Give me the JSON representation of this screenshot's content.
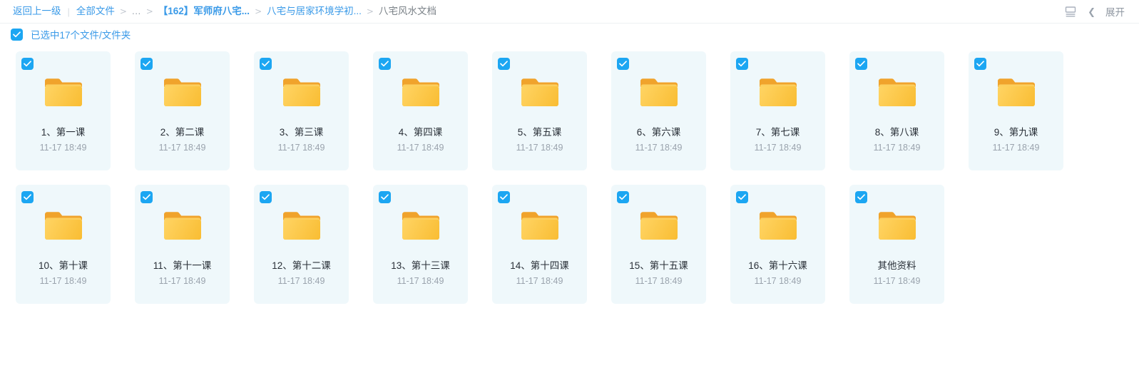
{
  "header": {
    "back_label": "返回上一级",
    "divider": "|",
    "separator": ">",
    "breadcrumb": [
      {
        "label": "全部文件",
        "style": "link"
      },
      {
        "label": "...",
        "style": "ellipsis"
      },
      {
        "label": "【162】军师府八宅...",
        "style": "strong"
      },
      {
        "label": "八宅与居家环境学初...",
        "style": "link"
      },
      {
        "label": "八宅风水文档",
        "style": "current"
      }
    ],
    "view_icon": "list-view-icon",
    "collapse_icon": "chevron-left-icon",
    "expand_label": "展开"
  },
  "selection": {
    "checked": true,
    "label": "已选中17个文件/文件夹"
  },
  "colors": {
    "accent": "#3a9ae8",
    "checkbox": "#1ca6f2",
    "card_bg": "#eff8fb",
    "folder_top": "#f3a72e",
    "folder_body": "#fdc63f",
    "name_text": "#2a3038",
    "date_text": "#9aa3ad"
  },
  "rows": [
    {
      "items": [
        {
          "name": "1、第一课",
          "date": "11-17 18:49",
          "checked": true,
          "icon": "folder-icon"
        },
        {
          "name": "2、第二课",
          "date": "11-17 18:49",
          "checked": true,
          "icon": "folder-icon"
        },
        {
          "name": "3、第三课",
          "date": "11-17 18:49",
          "checked": true,
          "icon": "folder-icon"
        },
        {
          "name": "4、第四课",
          "date": "11-17 18:49",
          "checked": true,
          "icon": "folder-icon"
        },
        {
          "name": "5、第五课",
          "date": "11-17 18:49",
          "checked": true,
          "icon": "folder-icon"
        },
        {
          "name": "6、第六课",
          "date": "11-17 18:49",
          "checked": true,
          "icon": "folder-icon"
        },
        {
          "name": "7、第七课",
          "date": "11-17 18:49",
          "checked": true,
          "icon": "folder-icon"
        },
        {
          "name": "8、第八课",
          "date": "11-17 18:49",
          "checked": true,
          "icon": "folder-icon"
        },
        {
          "name": "9、第九课",
          "date": "11-17 18:49",
          "checked": true,
          "icon": "folder-icon"
        }
      ]
    },
    {
      "items": [
        {
          "name": "10、第十课",
          "date": "11-17 18:49",
          "checked": true,
          "icon": "folder-icon"
        },
        {
          "name": "11、第十一课",
          "date": "11-17 18:49",
          "checked": true,
          "icon": "folder-icon"
        },
        {
          "name": "12、第十二课",
          "date": "11-17 18:49",
          "checked": true,
          "icon": "folder-icon"
        },
        {
          "name": "13、第十三课",
          "date": "11-17 18:49",
          "checked": true,
          "icon": "folder-icon"
        },
        {
          "name": "14、第十四课",
          "date": "11-17 18:49",
          "checked": true,
          "icon": "folder-icon"
        },
        {
          "name": "15、第十五课",
          "date": "11-17 18:49",
          "checked": true,
          "icon": "folder-icon"
        },
        {
          "name": "16、第十六课",
          "date": "11-17 18:49",
          "checked": true,
          "icon": "folder-icon"
        },
        {
          "name": "其他资料",
          "date": "11-17 18:49",
          "checked": true,
          "icon": "folder-icon"
        }
      ]
    }
  ]
}
